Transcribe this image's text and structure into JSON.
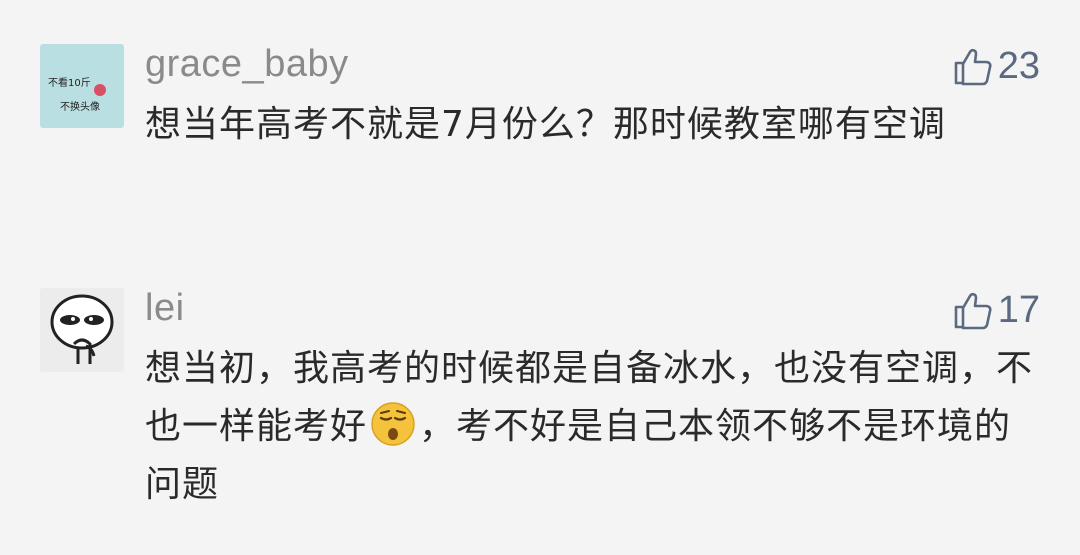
{
  "comments": [
    {
      "username": "grace_baby",
      "likes": "23",
      "avatar_text_1": "不看10斤",
      "avatar_text_2": "不换头像",
      "text": "想当年高考不就是7月份么？那时候教室哪有空调"
    },
    {
      "username": "lei",
      "likes": "17",
      "text_before_emoji": "想当初，我高考的时候都是自备冰水，也没有空调，不也一样能考好",
      "emoji": "sleepy-face-emoji",
      "text_after_emoji": "，考不好是自己本领不够不是环境的问题"
    }
  ],
  "icons": {
    "like": "thumbs-up-icon"
  },
  "colors": {
    "username": "#8a8a8a",
    "like": "#5b6a80",
    "text": "#2a2a2a",
    "background": "#f4f4f4"
  }
}
